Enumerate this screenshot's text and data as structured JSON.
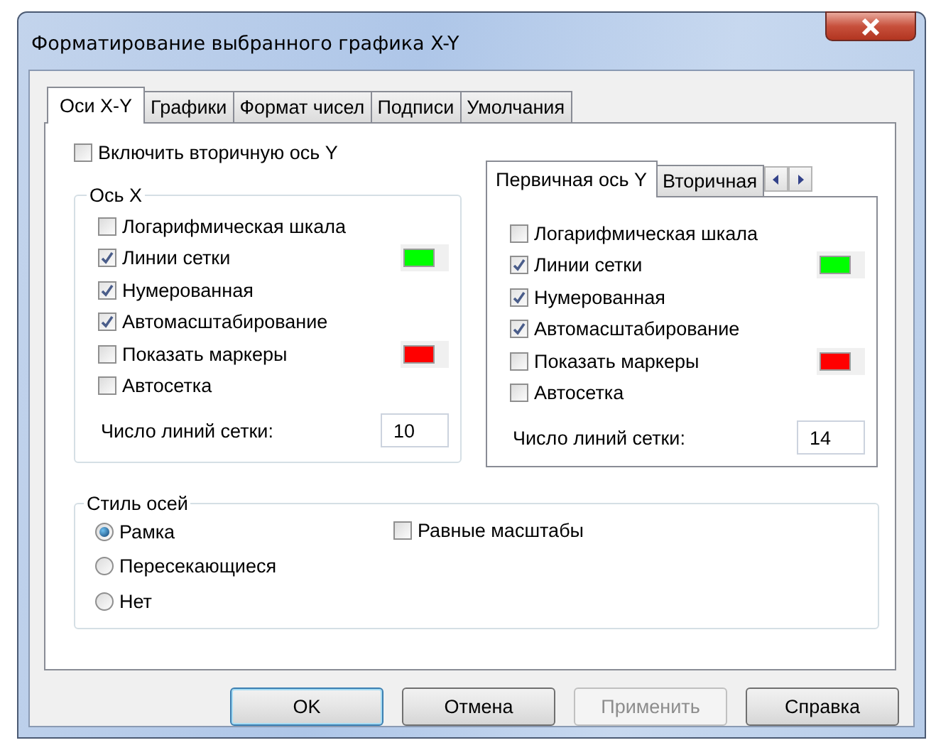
{
  "window": {
    "title": "Форматирование выбранного графика X-Y"
  },
  "tabs": [
    {
      "label": "Оси X-Y",
      "selected": true
    },
    {
      "label": "Графики",
      "selected": false
    },
    {
      "label": "Формат чисел",
      "selected": false
    },
    {
      "label": "Подписи",
      "selected": false
    },
    {
      "label": "Умолчания",
      "selected": false
    }
  ],
  "secondary_axis": {
    "label": "Включить вторичную ось Y",
    "checked": false
  },
  "x_axis": {
    "title": "Ось X",
    "options": [
      {
        "label": "Логарифмическая шкала",
        "checked": false
      },
      {
        "label": "Линии сетки",
        "checked": true,
        "color": "#00ff00"
      },
      {
        "label": "Нумерованная",
        "checked": true
      },
      {
        "label": "Автомасштабирование",
        "checked": true
      },
      {
        "label": "Показать маркеры",
        "checked": false,
        "color": "#ff0000"
      },
      {
        "label": "Автосетка",
        "checked": false
      }
    ],
    "grid_count_label": "Число линий сетки:",
    "grid_count": "10"
  },
  "y_axis": {
    "tabs": [
      {
        "label": "Первичная ось Y",
        "selected": true
      },
      {
        "label": "Вторичная",
        "selected": false
      }
    ],
    "options": [
      {
        "label": "Логарифмическая шкала",
        "checked": false
      },
      {
        "label": "Линии сетки",
        "checked": true,
        "color": "#00ff00"
      },
      {
        "label": "Нумерованная",
        "checked": true
      },
      {
        "label": "Автомасштабирование",
        "checked": true
      },
      {
        "label": "Показать маркеры",
        "checked": false,
        "color": "#ff0000"
      },
      {
        "label": "Автосетка",
        "checked": false
      }
    ],
    "grid_count_label": "Число линий сетки:",
    "grid_count": "14"
  },
  "axis_style": {
    "title": "Стиль осей",
    "radios": [
      {
        "label": "Рамка",
        "selected": true
      },
      {
        "label": "Пересекающиеся",
        "selected": false
      },
      {
        "label": "Нет",
        "selected": false
      }
    ],
    "equal_scales": {
      "label": "Равные масштабы",
      "checked": false
    }
  },
  "buttons": [
    {
      "label": "OK",
      "default": true,
      "disabled": false
    },
    {
      "label": "Отмена",
      "default": false,
      "disabled": false
    },
    {
      "label": "Применить",
      "default": false,
      "disabled": true
    },
    {
      "label": "Справка",
      "default": false,
      "disabled": false
    }
  ]
}
